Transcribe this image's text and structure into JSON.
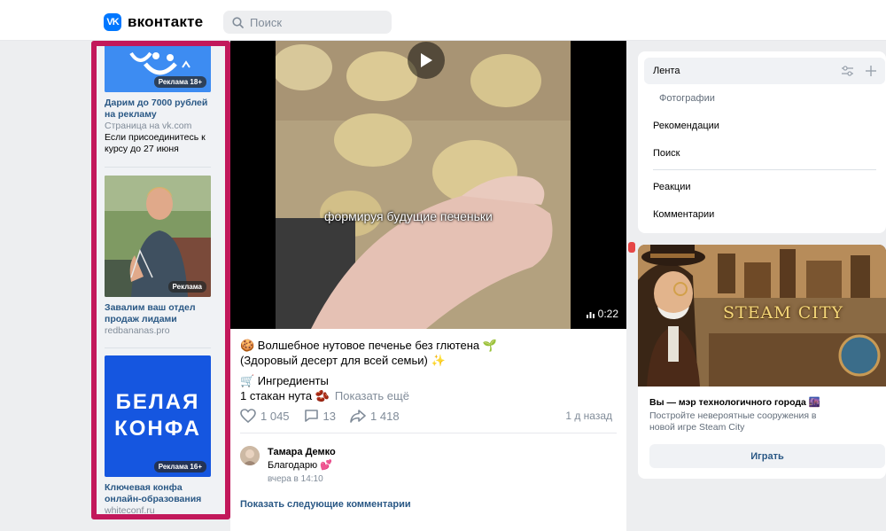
{
  "header": {
    "logo_mark": "VK",
    "logo_text": "вконтакте",
    "search_placeholder": "Поиск"
  },
  "ads": [
    {
      "badge": "Реклама 18+",
      "title": "Дарим до 7000 рублей на рекламу",
      "domain": "Страница на vk.com",
      "text": "Если присоединитесь к курсу до 27 июня"
    },
    {
      "badge": "Реклама",
      "title": "Завалим ваш отдел продаж лидами",
      "domain": "redbananas.pro",
      "text": ""
    },
    {
      "badge": "Реклама 16+",
      "image_text_1": "БЕЛАЯ",
      "image_text_2": "КОНФА",
      "title": "Ключевая конфа онлайн-образования",
      "domain": "whiteconf.ru",
      "text": ""
    }
  ],
  "post": {
    "video_caption": "формируя будущие печеньки",
    "video_duration": "0:22",
    "line1": "🍪 Волшебное нутовое печенье без глютена 🌱",
    "line2": "(Здоровый десерт для всей семьи) ✨",
    "line3": "🛒 Ингредиенты",
    "line4": "1 стакан нута 🫘",
    "show_more": "Показать ещё",
    "likes": "1 045",
    "comments": "13",
    "shares": "1 418",
    "date": "1 д назад"
  },
  "comment": {
    "author": "Тамара Демко",
    "text": "Благодарю 💕",
    "time": "вчера в 14:10"
  },
  "next_comments": "Показать следующие комментарии",
  "nav": {
    "items": [
      {
        "label": "Лента"
      },
      {
        "label": "Фотографии"
      },
      {
        "label": "Рекомендации"
      },
      {
        "label": "Поиск"
      },
      {
        "label": "Реакции"
      },
      {
        "label": "Комментарии"
      }
    ]
  },
  "promo": {
    "logo": "STEAM CITY",
    "title": "Вы — мэр технологичного города 🌆",
    "text": "Постройте невероятные сооружения в новой игре Steam City",
    "button": "Играть"
  },
  "colors": {
    "brand": "#0077ff",
    "link": "#2a5885",
    "highlight_frame": "#c2185b",
    "muted": "#818c99"
  }
}
